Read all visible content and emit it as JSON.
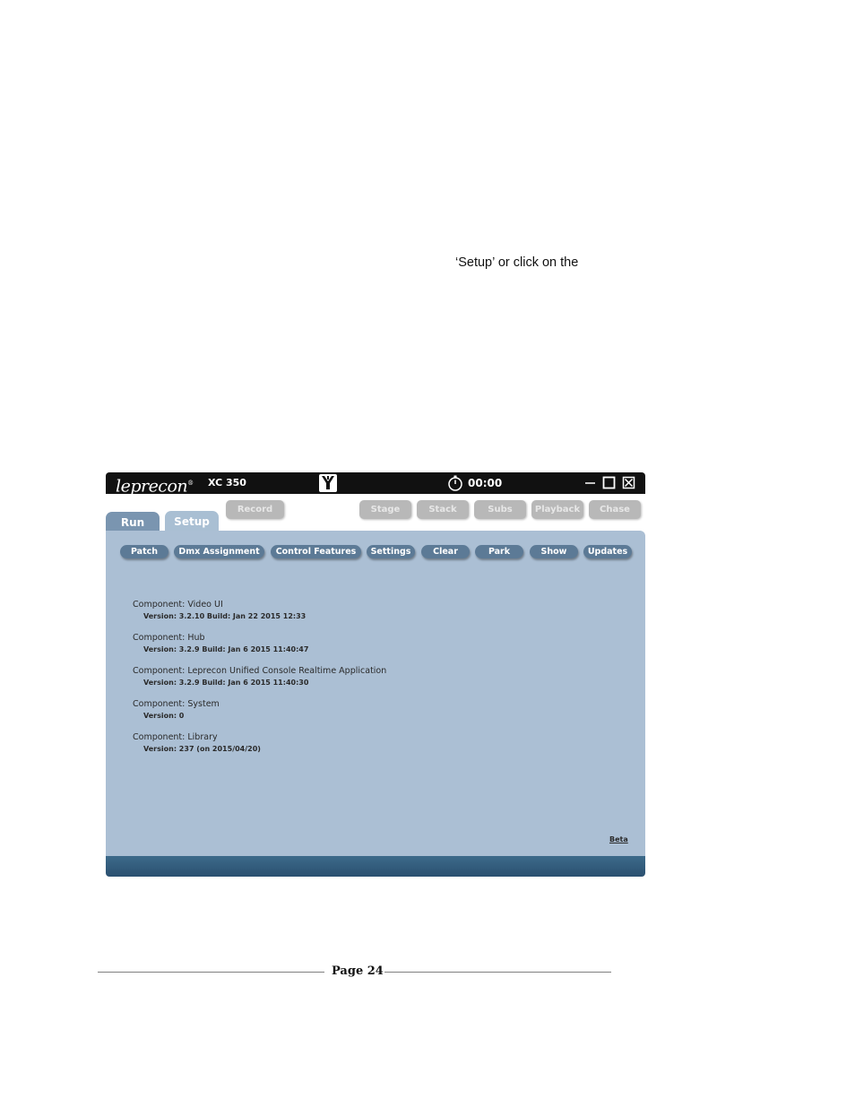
{
  "document": {
    "text_fragment": "‘Setup’ or click on the",
    "page_label": "Page 24"
  },
  "titlebar": {
    "logo": "leprecon",
    "model": "XC 350",
    "timer": "00:00",
    "icons": [
      "app-logo-icon",
      "stopwatch-icon",
      "minimize-icon",
      "maximize-icon",
      "close-icon"
    ]
  },
  "tabs": [
    {
      "label": "Run",
      "active": false
    },
    {
      "label": "Setup",
      "active": true
    }
  ],
  "mode_buttons": {
    "record": "Record",
    "stage": "Stage",
    "stack": "Stack",
    "subs": "Subs",
    "playback": "Playback",
    "chase": "Chase"
  },
  "setup_buttons": [
    {
      "label": "Patch"
    },
    {
      "label": "Dmx Assignment"
    },
    {
      "label": "Control Features"
    },
    {
      "label": "Settings"
    },
    {
      "label": "Clear"
    },
    {
      "label": "Park"
    },
    {
      "label": "Show"
    },
    {
      "label": "Updates"
    }
  ],
  "components": [
    {
      "name": "Component: Video UI",
      "version": "Version: 3.2.10 Build: Jan 22 2015 12:33"
    },
    {
      "name": "Component: Hub",
      "version": "Version: 3.2.9  Build: Jan  6 2015 11:40:47"
    },
    {
      "name": "Component: Leprecon Unified Console Realtime Application",
      "version": "Version: 3.2.9  Build: Jan  6 2015 11:40:30"
    },
    {
      "name": "Component: System",
      "version": "Version: 0"
    },
    {
      "name": "Component: Library",
      "version": "Version: 237  (on 2015/04/20)"
    }
  ],
  "beta_link": "Beta",
  "colors": {
    "panel": "#abbfd4",
    "button": "#5c7a96",
    "footer": "#2b5070",
    "titlebar": "#111111"
  }
}
